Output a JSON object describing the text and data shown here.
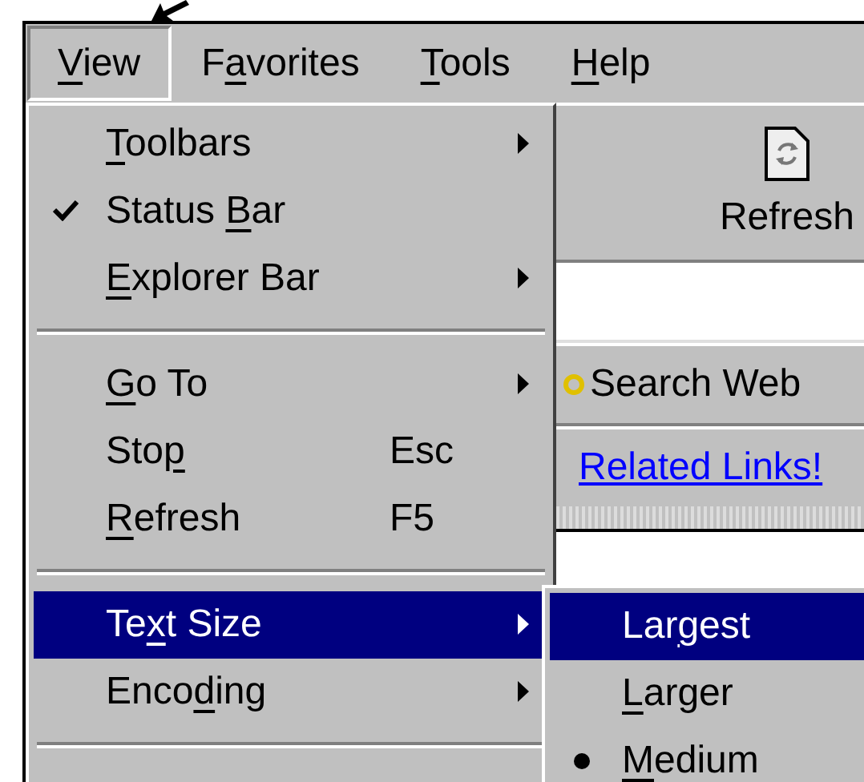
{
  "menu_bar": [
    {
      "label": {
        "key": "V",
        "post": "iew"
      },
      "selected": true
    },
    {
      "label": {
        "pre": "F",
        "key": "a",
        "post": "vorites"
      },
      "selected": false
    },
    {
      "label": {
        "key": "T",
        "post": "ools"
      },
      "selected": false
    },
    {
      "label": {
        "key": "H",
        "post": "elp"
      },
      "selected": false
    }
  ],
  "toolbar": {
    "buttons": [
      {
        "label": "Refresh"
      }
    ]
  },
  "links_bar": {
    "items": [
      {
        "kind": "button",
        "label": "Search Web"
      },
      {
        "kind": "link",
        "label": "Related Links!"
      }
    ]
  },
  "view_menu": {
    "items": [
      {
        "kind": "item",
        "label": {
          "key": "T",
          "post": "oolbars"
        },
        "checked": false,
        "submenu": true,
        "highlighted": false
      },
      {
        "kind": "item",
        "label": {
          "pre": "Status ",
          "key": "B",
          "post": "ar"
        },
        "checked": true,
        "submenu": false,
        "highlighted": false
      },
      {
        "kind": "item",
        "label": {
          "key": "E",
          "post": "xplorer Bar"
        },
        "checked": false,
        "submenu": true,
        "highlighted": false
      },
      {
        "kind": "separator"
      },
      {
        "kind": "item",
        "label": {
          "key": "G",
          "post": "o To"
        },
        "checked": false,
        "submenu": true,
        "highlighted": false
      },
      {
        "kind": "item",
        "label": {
          "pre": "Sto",
          "key": "p"
        },
        "shortcut": "Esc",
        "checked": false,
        "submenu": false,
        "highlighted": false
      },
      {
        "kind": "item",
        "label": {
          "key": "R",
          "post": "efresh"
        },
        "shortcut": "F5",
        "checked": false,
        "submenu": false,
        "highlighted": false
      },
      {
        "kind": "separator"
      },
      {
        "kind": "item",
        "label": {
          "pre": "Te",
          "key": "x",
          "post": "t Size"
        },
        "checked": false,
        "submenu": true,
        "highlighted": true
      },
      {
        "kind": "item",
        "label": {
          "pre": "Enco",
          "key": "d",
          "post": "ing"
        },
        "checked": false,
        "submenu": true,
        "highlighted": false
      },
      {
        "kind": "separator"
      }
    ]
  },
  "text_size_menu": {
    "items": [
      {
        "label": {
          "pre": "Lar",
          "key": "g",
          "post": "est"
        },
        "selected": false,
        "highlighted": true
      },
      {
        "label": {
          "key": "L",
          "post": "arger"
        },
        "selected": false,
        "highlighted": false
      },
      {
        "label": {
          "key": "M",
          "post": "edium"
        },
        "selected": true,
        "highlighted": false
      }
    ]
  }
}
